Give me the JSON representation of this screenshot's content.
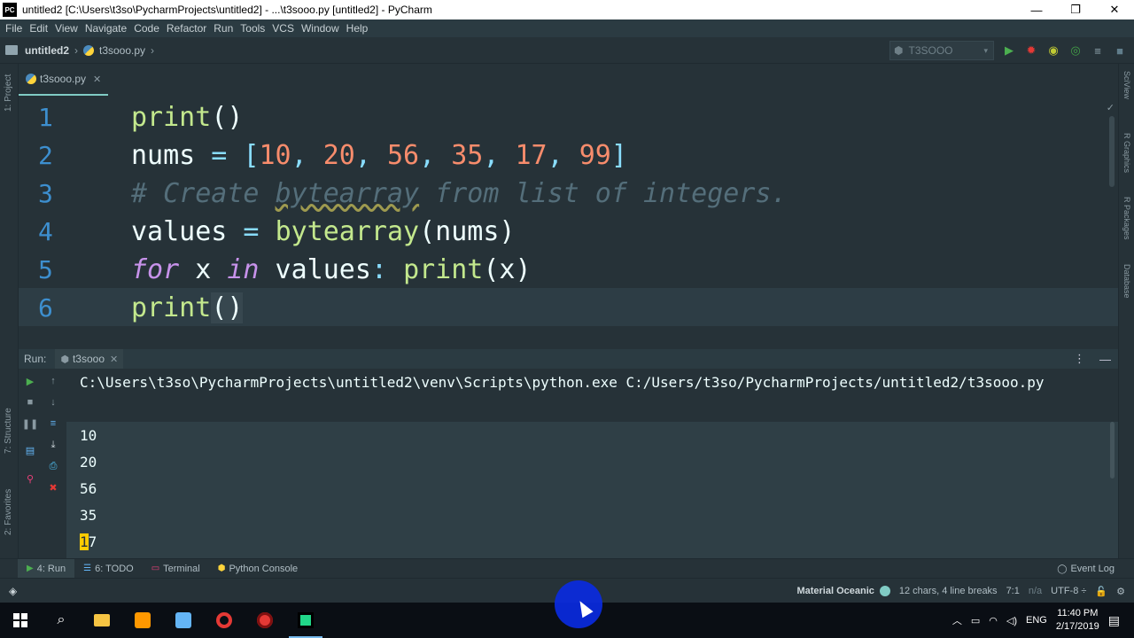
{
  "window": {
    "app_badge": "PC",
    "title": "untitled2 [C:\\Users\\t3so\\PycharmProjects\\untitled2] - ...\\t3sooo.py [untitled2] - PyCharm",
    "controls": [
      "—",
      "❐",
      "✕"
    ]
  },
  "menu": [
    "File",
    "Edit",
    "View",
    "Navigate",
    "Code",
    "Refactor",
    "Run",
    "Tools",
    "VCS",
    "Window",
    "Help"
  ],
  "breadcrumb": {
    "project": "untitled2",
    "file": "t3sooo.py",
    "chevron": "›"
  },
  "run_config": {
    "name": "T3SOOO",
    "chevron": "▾"
  },
  "left_strip": [
    "1: Project",
    "7: Structure",
    "2: Favorites"
  ],
  "right_strip": [
    "SciView",
    "R Graphics",
    "R Packages",
    "Database"
  ],
  "editor": {
    "tab_label": "t3sooo.py",
    "tab_close": "✕",
    "line_numbers": [
      "1",
      "2",
      "3",
      "4",
      "5",
      "6"
    ],
    "lines": [
      {
        "t1": "print",
        "t2": "()"
      },
      {
        "t1": "nums",
        "t2": " = ",
        "t3": "[",
        "n1": "10",
        "c1": ", ",
        "n2": "20",
        "c2": ", ",
        "n3": "56",
        "c3": ", ",
        "n4": "35",
        "c4": ", ",
        "n5": "17",
        "c5": ", ",
        "n6": "99",
        "t4": "]"
      },
      {
        "c_pre": "# Create ",
        "c_word": "bytearray",
        "c_post": " from list of integers."
      },
      {
        "t1": "values",
        "t2": " = ",
        "t3": "bytearray",
        "t4": "(nums)"
      },
      {
        "k1": "for",
        "t1": " x ",
        "k2": "in",
        "t2": " values",
        "t3": ": ",
        "t4": "print",
        "t5": "(x)"
      },
      {
        "t1": "print",
        "t2": "()"
      }
    ]
  },
  "run_panel": {
    "label": "Run:",
    "tab": "t3sooo",
    "tab_close": "✕",
    "menu_icon": "⋮",
    "minimize_icon": "—",
    "command": "C:\\Users\\t3so\\PycharmProjects\\untitled2\\venv\\Scripts\\python.exe C:/Users/t3so/PycharmProjects/untitled2/t3sooo.py",
    "output": [
      "10",
      "20",
      "56",
      "35"
    ],
    "last_output_first": "1",
    "last_output_rest": "7"
  },
  "bottom_tools": {
    "run": "4: Run",
    "todo": "6: TODO",
    "terminal": "Terminal",
    "python_console": "Python Console",
    "event_log": "Event Log"
  },
  "status": {
    "theme": "Material Oceanic",
    "selection": "12 chars, 4 line breaks",
    "position": "7:1",
    "separator": "n/a",
    "encoding": "UTF-8 ÷"
  },
  "taskbar": {
    "language": "ENG",
    "time": "11:40 PM",
    "date": "2/17/2019"
  },
  "colors": {
    "editor_bg": "#263238",
    "function": "#c3e88d",
    "number": "#f78c6c",
    "keyword": "#c792ea",
    "comment": "#546e7a",
    "accent": "#80cbc4"
  }
}
